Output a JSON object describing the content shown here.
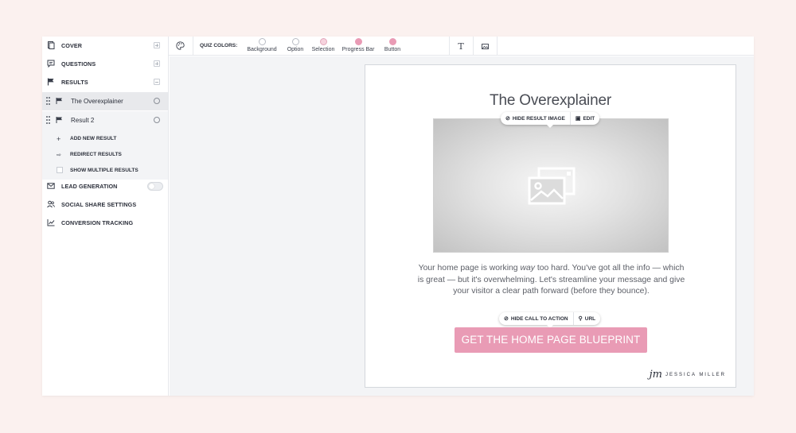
{
  "sidebar": {
    "cover_label": "COVER",
    "questions_label": "QUESTIONS",
    "results_label": "RESULTS",
    "results": [
      {
        "label": "The Overexplainer"
      },
      {
        "label": "Result 2"
      }
    ],
    "add_new_result": "ADD NEW RESULT",
    "redirect_results": "REDIRECT RESULTS",
    "show_multiple_results": "SHOW MULTIPLE RESULTS",
    "lead_generation": "LEAD GENERATION",
    "social_share_settings": "SOCIAL SHARE SETTINGS",
    "conversion_tracking": "CONVERSION TRACKING"
  },
  "toolbar": {
    "quiz_colors_label": "QUIZ COLORS:",
    "colors": [
      {
        "label": "Background",
        "color": "#ffffff"
      },
      {
        "label": "Option",
        "color": "#ffffff"
      },
      {
        "label": "Selection",
        "color": "#f6d3de"
      },
      {
        "label": "Progress Bar",
        "color": "#e99bb5"
      },
      {
        "label": "Button",
        "color": "#e99bb5"
      }
    ],
    "text_tool_icon": "text-icon",
    "image_tool_icon": "image-icon"
  },
  "preview": {
    "title": "The Overexplainer",
    "hide_result_image": "HIDE RESULT IMAGE",
    "edit": "EDIT",
    "description_part1": "Your home page is working ",
    "description_em": "way",
    "description_part2": " too hard. You've got all the info — which is great — but it's overwhelming. Let's streamline your message and give your visitor a clear path forward (before they bounce).",
    "hide_call_to_action": "HIDE CALL TO ACTION",
    "url": "URL",
    "cta_label": "GET THE HOME PAGE BLUEPRINT",
    "logo_mark": "jm",
    "logo_name": "JESSICA MILLER",
    "accent_color": "#e99bb5"
  }
}
